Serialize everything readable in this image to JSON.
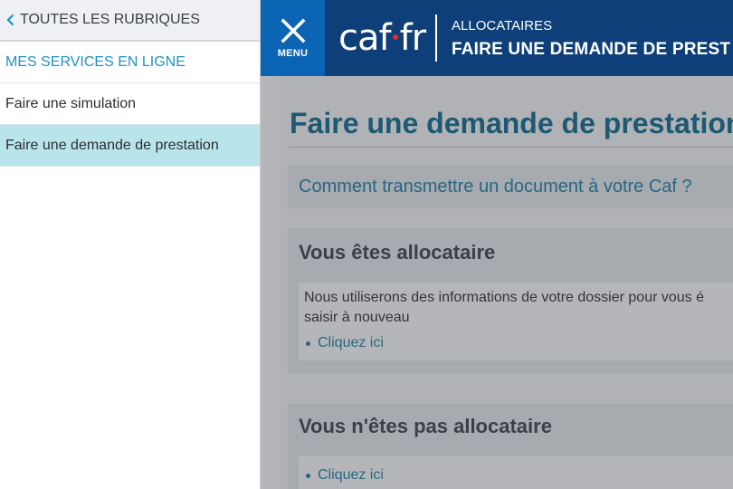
{
  "sidebar": {
    "back_label": "TOUTES LES RUBRIQUES",
    "section_label": "MES SERVICES EN LIGNE",
    "items": [
      {
        "label": "Faire une simulation",
        "active": false
      },
      {
        "label": "Faire une demande de prestation",
        "active": true
      }
    ]
  },
  "header": {
    "menu_label": "MENU",
    "logo_left": "caf",
    "logo_right": "fr",
    "kicker": "ALLOCATAIRES",
    "title": "FAIRE UNE DEMANDE DE PREST"
  },
  "main": {
    "page_title": "Faire une demande de prestation",
    "doc_link": "Comment transmettre un document à votre Caf ?",
    "allocataire": {
      "heading": "Vous êtes allocataire",
      "text_line1": "Nous utiliserons des informations de votre dossier pour vous é",
      "text_line2": "saisir à nouveau",
      "link": "Cliquez ici"
    },
    "non_allocataire": {
      "heading": "Vous n'êtes pas allocataire",
      "link": "Cliquez ici"
    }
  },
  "colors": {
    "header_bg": "#0f3f78",
    "menu_bg": "#0b64b4",
    "accent": "#1d92c5",
    "active_item": "#b9e4ec",
    "logo_dot": "#e42a2a"
  }
}
